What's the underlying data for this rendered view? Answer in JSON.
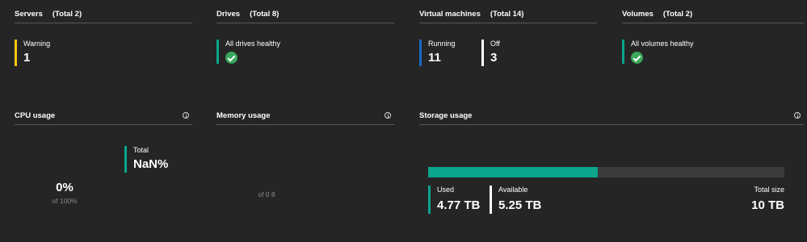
{
  "summary_tiles": {
    "servers": {
      "title": "Servers",
      "total": "(Total 2)",
      "stats": [
        {
          "label": "Warning",
          "value": "1",
          "color": "#f2c811"
        }
      ]
    },
    "drives": {
      "title": "Drives",
      "total": "(Total 8)",
      "stats": [
        {
          "label": "All drives healthy",
          "icon": "check-circle-icon",
          "color": "#0aa58c"
        }
      ]
    },
    "virtual_machines": {
      "title": "Virtual machines",
      "total": "(Total 14)",
      "stats": [
        {
          "label": "Running",
          "value": "11",
          "color": "#1c67c4"
        },
        {
          "label": "Off",
          "value": "3",
          "color": "#ffffff"
        }
      ]
    },
    "volumes": {
      "title": "Volumes",
      "total": "(Total 2)",
      "stats": [
        {
          "label": "All volumes healthy",
          "icon": "check-circle-icon",
          "color": "#0aa58c"
        }
      ]
    }
  },
  "cpu_usage": {
    "title": "CPU usage",
    "info_icon": "info-icon",
    "value": "0%",
    "of_text": "of 100%",
    "total_label": "Total",
    "total_value": "NaN%",
    "total_color": "#0aa58c"
  },
  "memory_usage": {
    "title": "Memory usage",
    "info_icon": "info-icon",
    "of_text": "of 0 8"
  },
  "storage_usage": {
    "title": "Storage usage",
    "info_icon": "info-icon",
    "used_fraction": 0.477,
    "used_label": "Used",
    "used_value": "4.77 TB",
    "used_color": "#0aa58c",
    "available_label": "Available",
    "available_value": "5.25 TB",
    "available_color": "#ffffff",
    "total_label": "Total size",
    "total_value": "10 TB"
  },
  "colors": {
    "background": "#252525",
    "divider": "#5a5a5a",
    "healthy": "#3aa85a",
    "bar_track": "#3a3a3a"
  }
}
